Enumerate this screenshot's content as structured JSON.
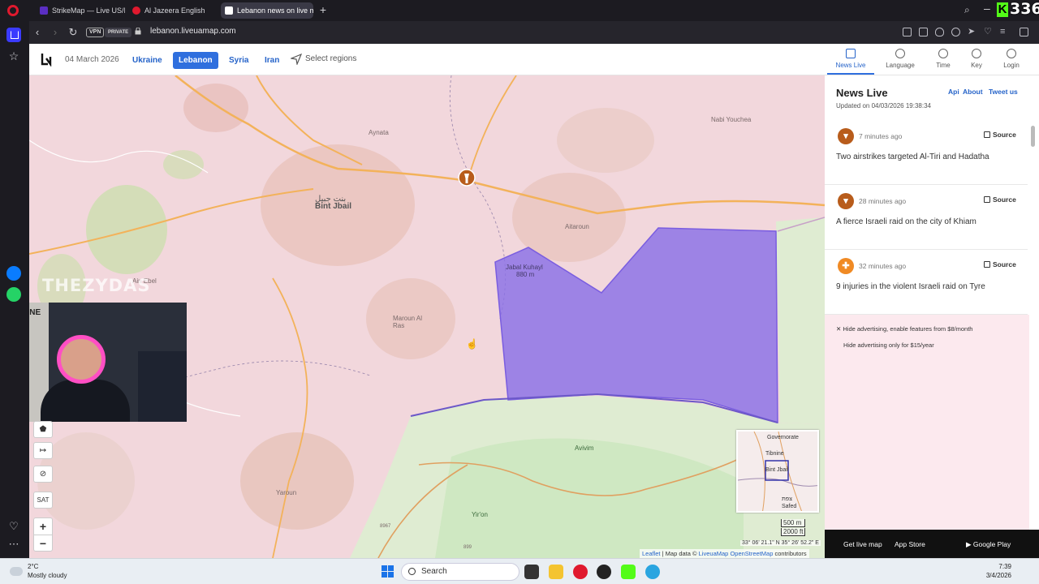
{
  "browser": {
    "tabs": [
      {
        "label": "StrikeMap — Live US/Isra",
        "fav_color": "#5a2ec2"
      },
      {
        "label": "Al Jazeera English",
        "fav_color": "#e0192e"
      },
      {
        "label": "Lebanon news on live ma",
        "fav_color": "#ffffff"
      }
    ],
    "overlay_number": "336",
    "vpn_label": "VPN",
    "private_label": "PRIVATE",
    "url": "lebanon.liveuamap.com"
  },
  "site": {
    "date": "04 March 2026",
    "regions": [
      "Ukraine",
      "Lebanon",
      "Syria",
      "Iran"
    ],
    "active_region": "Lebanon",
    "select_regions_label": "Select regions",
    "header_tabs": [
      "News Live",
      "Language",
      "Time",
      "Key",
      "Login"
    ]
  },
  "map": {
    "watermark": "THEZYDAS",
    "sticker_text": "GG ZONE",
    "places": {
      "bint_jbail": "Bint Jbail",
      "bint_jbail_ar": "بنت جبيل",
      "aynata": "Aynata",
      "maroun": "Maroun Al Ras",
      "yaroun": "Yaroun",
      "ain_ebel": "Ain Ebel",
      "nabi_youchea": "Nabi Youchea",
      "jabal_kuhayl": "Jabal Kuhayl",
      "jabal_kuhayl_elev": "880 m",
      "avivim": "Avivim",
      "yiron": "Yir'on",
      "aitaroun": "Aitaroun"
    },
    "controls": {
      "sat": "SAT",
      "zoom_in": "+",
      "zoom_out": "−"
    },
    "minimap": {
      "governorate": "Governorate",
      "tibnine": "Tibnine",
      "bint_jbail": "Bint Jbail",
      "safed": "Safed",
      "tzfat": "צפת"
    },
    "scale": [
      "500 m",
      "2000 ft"
    ],
    "coords": "33° 06' 21.1\" N 35° 26' 52.2\" E",
    "attribution": {
      "leaflet": "Leaflet",
      "map_data": "| Map data ©",
      "liveuamap": "LiveuaMap",
      "osm": "OpenStreetMap",
      "contributors": "contributors"
    },
    "road_labels": [
      "8967",
      "899"
    ]
  },
  "panel": {
    "title": "News Live",
    "links": [
      "Api",
      "About",
      "Tweet us"
    ],
    "updated": "Updated on 04/03/2026 19:38:34",
    "source_label": "Source",
    "items": [
      {
        "time": "7 minutes ago",
        "text": "Two airstrikes targeted Al-Tiri and Hadatha",
        "icon_color": "#b85c1b"
      },
      {
        "time": "28 minutes ago",
        "text": "A fierce Israeli raid on the city of Khiam",
        "icon_color": "#b85c1b"
      },
      {
        "time": "32 minutes ago",
        "text": "9 injuries in the violent Israeli raid on Tyre",
        "icon_color": "#f08a24"
      }
    ],
    "ads": [
      "Hide advertising, enable features from $8/month",
      "Hide advertising only for $15/year"
    ],
    "apps": [
      "Get live map",
      "App Store",
      "Google Play"
    ]
  },
  "taskbar": {
    "temp": "2°C",
    "weather": "Mostly cloudy",
    "search": "Search",
    "time": "7:39",
    "date": "3/4/2026"
  },
  "colors": {
    "accent": "#2f6fde",
    "occupied_zone": "#8a70e6",
    "map_bg": "#f2d7dc",
    "israel_green": "#cfe8c2"
  }
}
